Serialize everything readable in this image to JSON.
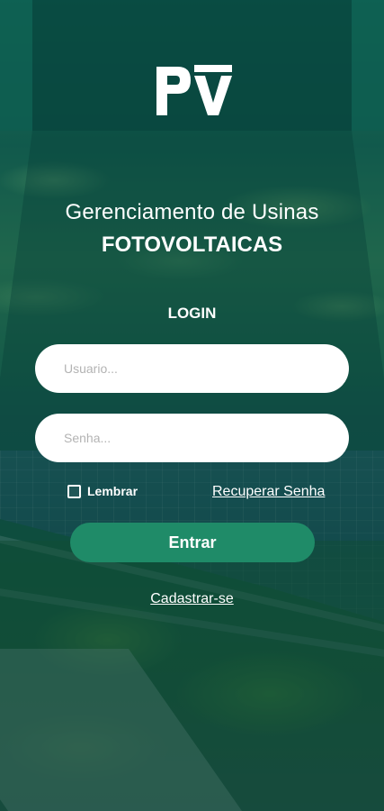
{
  "brand": {
    "logo_text": "PV",
    "accent_color": "#1f8b68"
  },
  "header": {
    "title_line1": "Gerenciamento de Usinas",
    "title_line2": "FOTOVOLTAICAS"
  },
  "login": {
    "heading": "LOGIN",
    "username_placeholder": "Usuario...",
    "password_placeholder": "Senha...",
    "remember_label": "Lembrar",
    "remember_checked": false,
    "recover_label": "Recuperar Senha",
    "submit_label": "Entrar",
    "signup_label": "Cadastrar-se"
  }
}
